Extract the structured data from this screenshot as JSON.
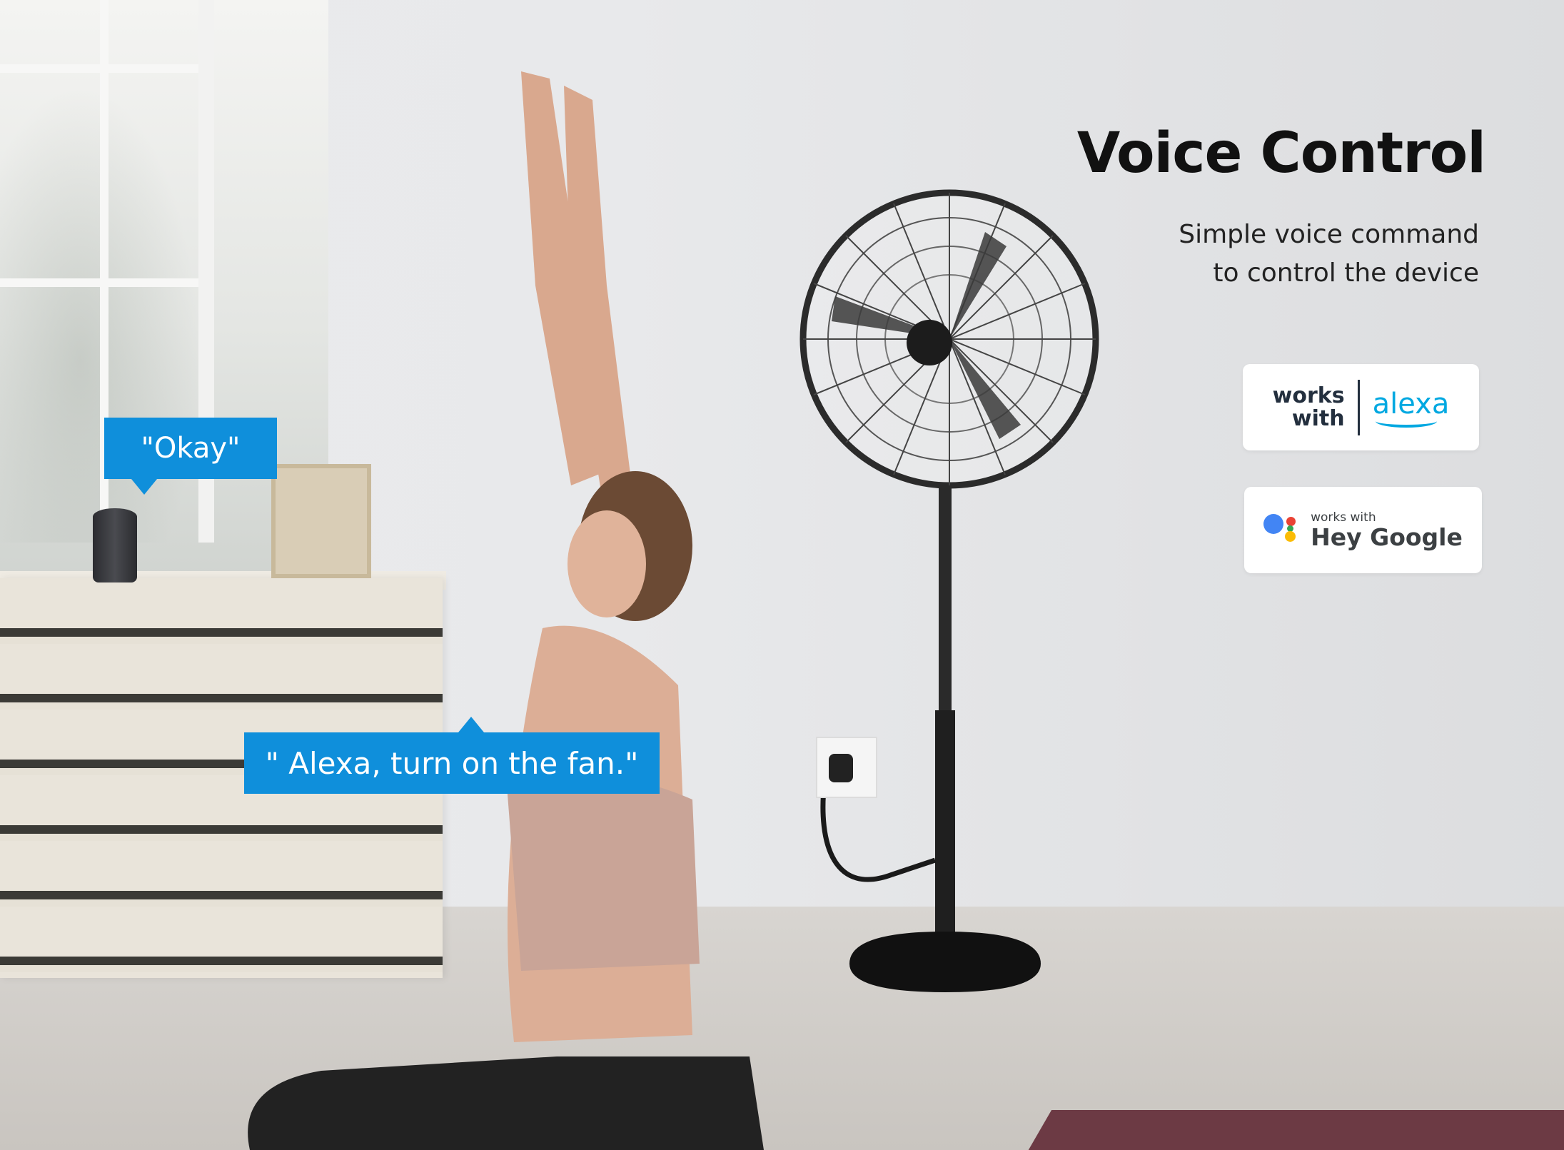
{
  "headline": "Voice Control",
  "subtext": {
    "line1": "Simple voice command",
    "line2": "to control the device"
  },
  "badges": {
    "alexa": {
      "works_line1": "works",
      "works_line2": "with",
      "brand": "alexa",
      "icon": "amazon-smile-icon",
      "brand_color": "#00a8e1"
    },
    "google": {
      "small": "works with",
      "big": "Hey Google",
      "icon": "google-assistant-icon"
    }
  },
  "speech_bubbles": {
    "speaker_reply": "\"Okay\"",
    "user_command": "\" Alexa, turn on the fan.\""
  },
  "colors": {
    "bubble": "#0f8fdb",
    "headline": "#111111",
    "badge_bg": "#ffffff"
  }
}
